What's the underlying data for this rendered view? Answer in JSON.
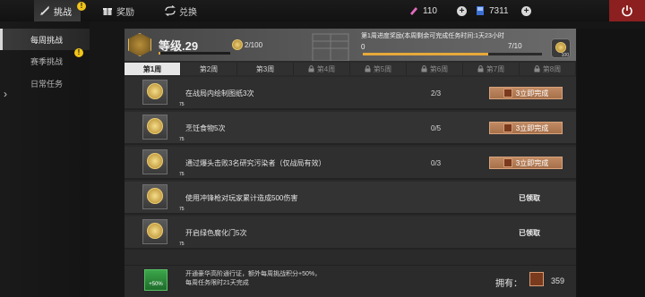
{
  "topbar": {
    "tabs": [
      {
        "label": "挑战",
        "icon": "sword-icon",
        "active": true
      },
      {
        "label": "奖励",
        "icon": "gift-icon",
        "active": false
      },
      {
        "label": "兑换",
        "icon": "exchange-icon",
        "active": false
      }
    ],
    "currency_pink": "110",
    "currency_blue": "7311"
  },
  "sidebar": {
    "items": [
      {
        "label": "每周挑战",
        "active": true
      },
      {
        "label": "赛季挑战",
        "active": false
      },
      {
        "label": "日常任务",
        "active": false
      }
    ]
  },
  "header": {
    "level_label": "等级.29",
    "level_progress": "2/100",
    "level_progress_fraction": 0.02,
    "weekly_reward_title": "第1周进度奖励(本周剩余可完成任务时间:1天23小时",
    "weekly_progress_start": "0",
    "weekly_progress": "7/10",
    "weekly_progress_fraction": 0.7,
    "weekly_reward_count": "100"
  },
  "week_tabs": [
    {
      "label": "第1周",
      "state": "active"
    },
    {
      "label": "第2周",
      "state": "open"
    },
    {
      "label": "第3周",
      "state": "open"
    },
    {
      "label": "第4周",
      "state": "locked"
    },
    {
      "label": "第5周",
      "state": "locked"
    },
    {
      "label": "第6周",
      "state": "locked"
    },
    {
      "label": "第7周",
      "state": "locked"
    },
    {
      "label": "第8周",
      "state": "locked"
    }
  ],
  "tasks": [
    {
      "reward": "75",
      "text": "在战局内绘制图纸3次",
      "progress": "2/3",
      "action": "3立即完成",
      "status": "incomplete"
    },
    {
      "reward": "75",
      "text": "烹饪食物5次",
      "progress": "0/5",
      "action": "3立即完成",
      "status": "incomplete"
    },
    {
      "reward": "75",
      "text": "通过爆头击败3名研究污染者（仅战局有效）",
      "progress": "0/3",
      "action": "3立即完成",
      "status": "incomplete"
    },
    {
      "reward": "75",
      "text": "使用冲锋枪对玩家累计造成500伤害",
      "progress": "",
      "action": "已领取",
      "status": "claimed"
    },
    {
      "reward": "75",
      "text": "开启绿色腐化门5次",
      "progress": "",
      "action": "已领取",
      "status": "claimed"
    }
  ],
  "footer": {
    "pass_badge": "+50%",
    "line1": "开通豪华高阶通行证，额外每周挑战积分+50%，",
    "line2": "每周任务限时21天完成",
    "own_label": "拥有：",
    "own_count": "359"
  },
  "colors": {
    "accent_gold": "#d9a23b",
    "complete_button": "#b37a52",
    "power_button": "#8c1f1f",
    "pass_green": "#2f8f3d"
  }
}
